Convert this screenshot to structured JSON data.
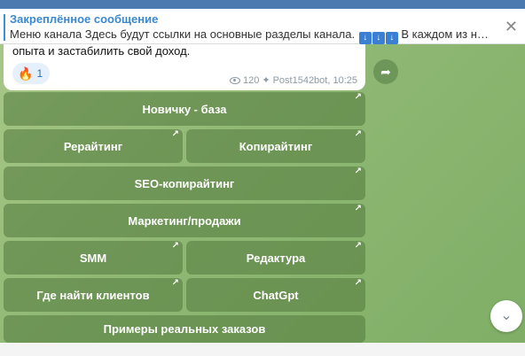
{
  "pinned": {
    "title": "Закреплённое сообщение",
    "text_before": "Меню канала  Здесь будут ссылки на основные разделы канала. ",
    "emoji_icons": [
      "down-arrow-emoji-icon",
      "down-arrow-emoji-icon",
      "down-arrow-emoji-icon"
    ],
    "text_after": " В каждом из них ест..."
  },
  "message": {
    "text": "опыта и застабилить свой доход.",
    "reaction_icon": "fire-icon",
    "reaction_count": "1",
    "views": "120",
    "author": "Post1542bot, 10:25"
  },
  "keyboard": {
    "rows": [
      [
        "Новичку - база"
      ],
      [
        "Рерайтинг",
        "Копирайтинг"
      ],
      [
        "SEO-копирайтинг"
      ],
      [
        "Маркетинг/продажи"
      ],
      [
        "SMM",
        "Редактура"
      ],
      [
        "Где найти клиентов",
        "ChatGpt"
      ],
      [
        "Примеры реальных заказов"
      ]
    ],
    "link_icon": "external-arrow-icon"
  },
  "icons": {
    "close": "close-icon",
    "share": "share-icon",
    "scroll_down": "chevron-down-icon",
    "views": "eye-icon",
    "pin": "pin-icon"
  },
  "colors": {
    "accent": "#3a88cf",
    "button_bg": "#5a8042",
    "background": "#8fb874"
  }
}
